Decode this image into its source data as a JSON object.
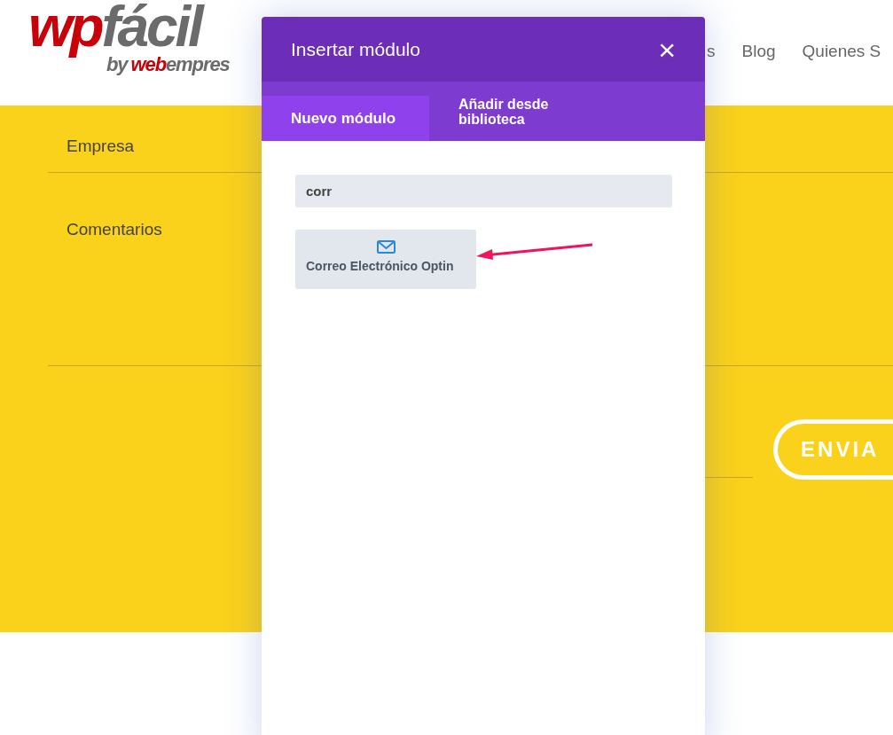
{
  "logo": {
    "first": "wp",
    "second": "fácil",
    "by": "by",
    "brand_a": "web",
    "brand_b": "empres"
  },
  "nav": [
    "s",
    "Blog",
    "Quienes S"
  ],
  "form": {
    "fields": [
      "Empresa",
      "Comentarios"
    ],
    "submit": "ENVIA"
  },
  "dialog": {
    "title": "Insertar módulo",
    "close": "×",
    "tabs": [
      {
        "label": "Nuevo módulo",
        "selected": true
      },
      {
        "label": "Añadir desde biblioteca",
        "selected": false
      }
    ],
    "search": {
      "value": "corr"
    },
    "modules": [
      {
        "label": "Correo Electrónico Optin"
      }
    ]
  }
}
